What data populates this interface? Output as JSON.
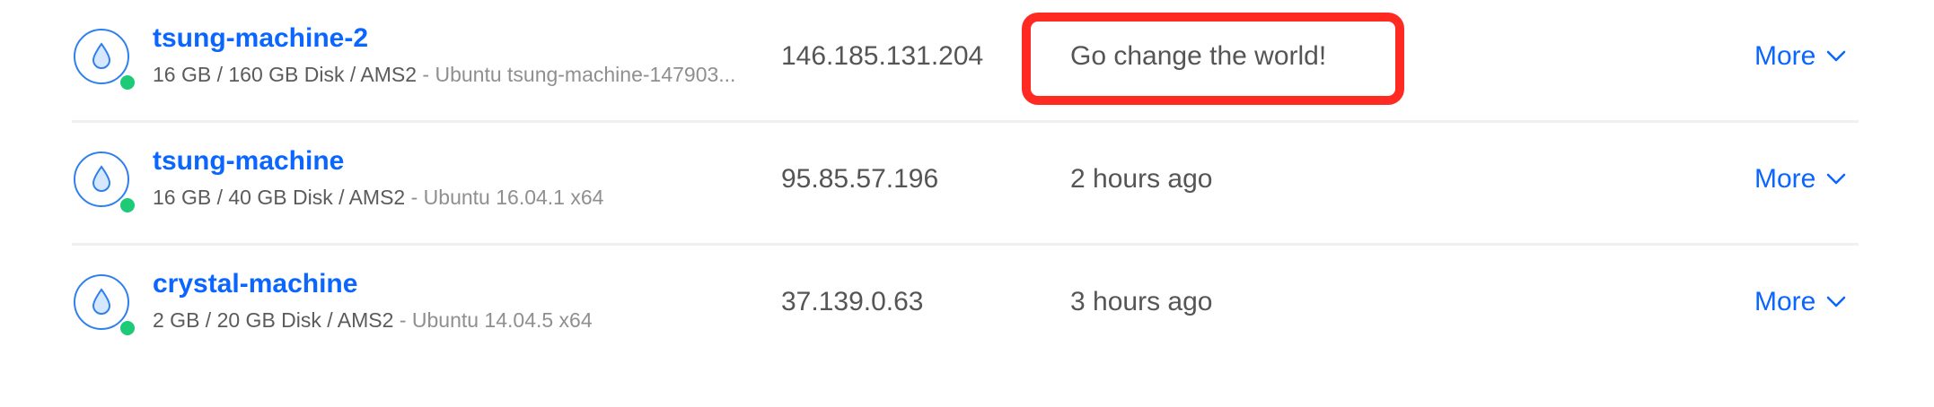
{
  "droplets": [
    {
      "name": "tsung-machine-2",
      "specs": "16 GB / 160 GB Disk / AMS2",
      "os": " - Ubuntu tsung-machine-147903...",
      "ip": "146.185.131.204",
      "created": "Go change the world!",
      "more_label": "More",
      "status": "active"
    },
    {
      "name": "tsung-machine",
      "specs": "16 GB / 40 GB Disk / AMS2",
      "os": " - Ubuntu 16.04.1 x64",
      "ip": "95.85.57.196",
      "created": "2 hours ago",
      "more_label": "More",
      "status": "active"
    },
    {
      "name": "crystal-machine",
      "specs": "2 GB / 20 GB Disk / AMS2",
      "os": " - Ubuntu 14.04.5 x64",
      "ip": "37.139.0.63",
      "created": "3 hours ago",
      "more_label": "More",
      "status": "active"
    }
  ],
  "colors": {
    "link": "#0a66ff",
    "status_active": "#1dca78",
    "highlight": "#ff2a22"
  },
  "icons": {
    "droplet": "droplet-icon",
    "status": "status-dot-icon",
    "more": "chevron-down-icon"
  }
}
